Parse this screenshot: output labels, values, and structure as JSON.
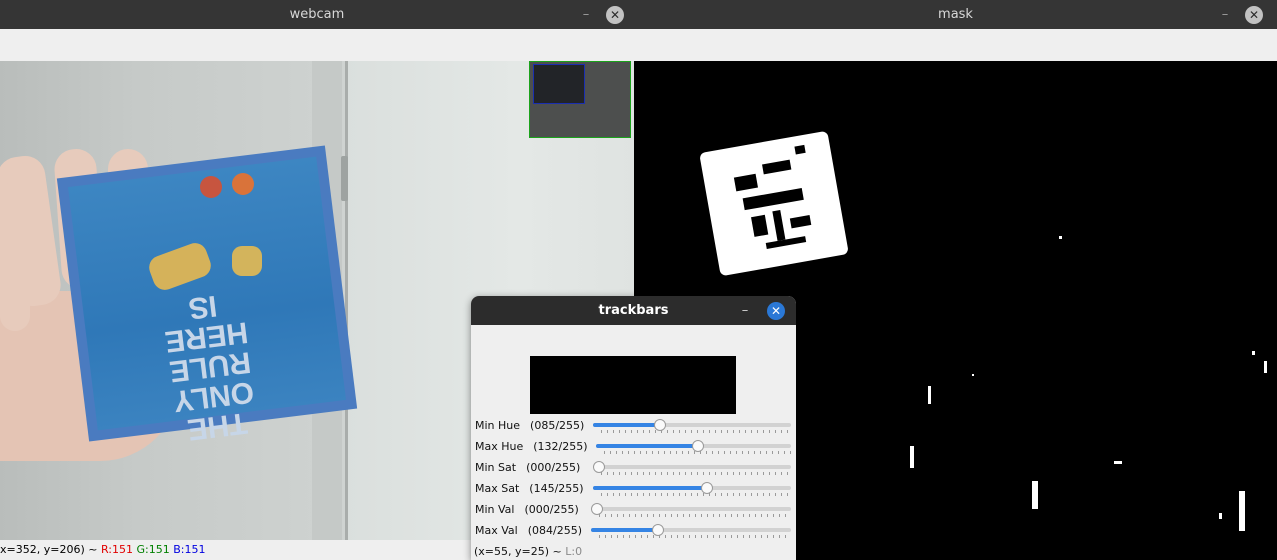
{
  "windows": {
    "webcam": {
      "title": "webcam",
      "status": {
        "coords": "x=352, y=206) ~ ",
        "r": "R:151",
        "g": "G:151",
        "b": "B:151"
      },
      "box_text": "THE ONLY RULE HERE IS"
    },
    "mask": {
      "title": "mask"
    },
    "trackbars": {
      "title": "trackbars",
      "sliders": [
        {
          "label": "Min Hue",
          "value_text": "(085/255)",
          "value": 85,
          "max": 255
        },
        {
          "label": "Max Hue",
          "value_text": "(132/255)",
          "value": 132,
          "max": 255
        },
        {
          "label": "Min Sat",
          "value_text": "(000/255)",
          "value": 0,
          "max": 255
        },
        {
          "label": "Max Sat",
          "value_text": "(145/255)",
          "value": 145,
          "max": 255
        },
        {
          "label": "Min Val",
          "value_text": "(000/255)",
          "value": 0,
          "max": 255
        },
        {
          "label": "Max Val",
          "value_text": "(084/255)",
          "value": 84,
          "max": 255
        }
      ],
      "status": {
        "coords": "(x=55, y=25) ~ ",
        "l": "L:0"
      }
    }
  },
  "controls": {
    "minimize_glyph": "–",
    "close_glyph": "✕"
  },
  "colors": {
    "slider_accent": "#3584e4",
    "close_active": "#2a78d6",
    "status_r": "#e00000",
    "status_g": "#008000",
    "status_b": "#0000e0",
    "detect_outline": "#4a7bc0"
  }
}
